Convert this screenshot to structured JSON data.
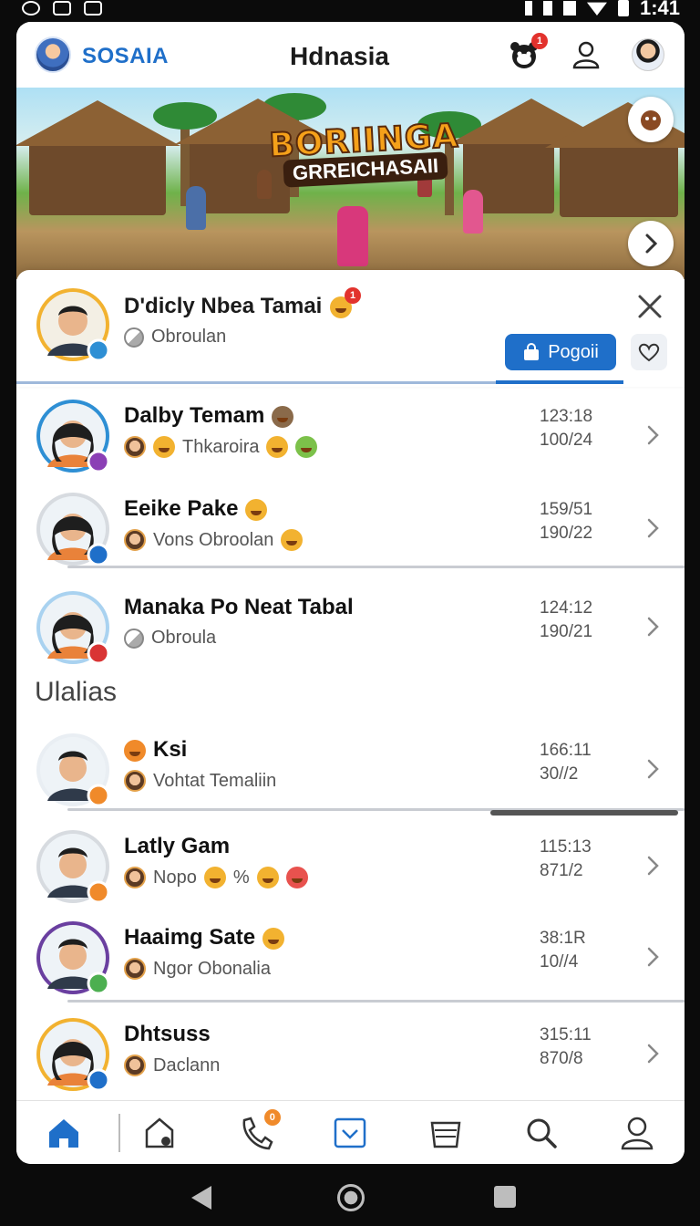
{
  "status_bar": {
    "time": "1:41"
  },
  "header": {
    "brand": "SOSAIA",
    "title": "Hdnasia",
    "notification_count": "1"
  },
  "banner": {
    "title_line1": "BORIINGA",
    "title_line2": "GRREICHASAII"
  },
  "featured": {
    "name": "D'dicly Nbea Tamai",
    "badge": "1",
    "status": "Obroulan",
    "action_label": "Pogoii"
  },
  "chats": [
    {
      "name": "Dalby Temam",
      "status": "Thkaroira",
      "time": "123:18",
      "date": "100/24",
      "ring": "#2e8fd4",
      "badge": "#8b3fb5"
    },
    {
      "name": "Eeike Pake",
      "status": "Vons Obroolan",
      "time": "159/51",
      "date": "190/22",
      "ring": "#d7dbe0",
      "badge": "#1f6fc9"
    },
    {
      "name": "Manaka Po Neat Tabal",
      "status": "Obroula",
      "time": "124:12",
      "date": "190/21",
      "ring": "#a9d2f0",
      "badge": "#d93434"
    }
  ],
  "section": {
    "title": "Ulalias"
  },
  "others": [
    {
      "name": "Ksi",
      "status": "Vohtat Temaliin",
      "time": "166:11",
      "date": "30//2",
      "ring": "#e9eef3",
      "badge": "#f08a2a"
    },
    {
      "name": "Latly Gam",
      "status": "Nopo",
      "extra": "%",
      "time": "115:13",
      "date": "871/2",
      "ring": "#d7dbe0",
      "badge": "#f08a2a"
    },
    {
      "name": "Haaimg Sate",
      "status": "Ngor Obonalia",
      "time": "38:1R",
      "date": "10//4",
      "ring": "#6a3fa0",
      "badge": "#4caf50"
    },
    {
      "name": "Dhtsuss",
      "status": "Daclann",
      "time": "315:11",
      "date": "870/8",
      "ring": "#f2b230",
      "badge": "#1f6fc9"
    }
  ],
  "bottom_nav": {
    "calls_badge": "0"
  },
  "colors": {
    "accent": "#1f6fc9",
    "badge_red": "#e2322d"
  }
}
